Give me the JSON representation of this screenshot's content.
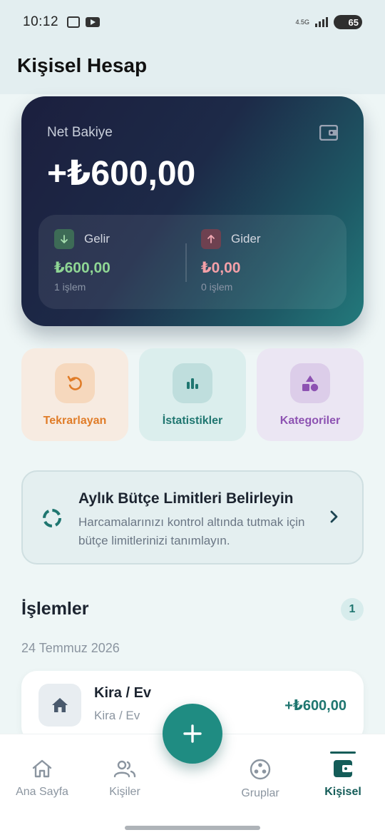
{
  "status_bar": {
    "time": "10:12",
    "network": "4.5G",
    "battery": "65"
  },
  "header": {
    "title": "Kişisel Hesap"
  },
  "balance": {
    "label": "Net Bakiye",
    "amount": "+₺600,00",
    "income": {
      "label": "Gelir",
      "amount": "₺600,00",
      "count": "1 işlem"
    },
    "expense": {
      "label": "Gider",
      "amount": "₺0,00",
      "count": "0 işlem"
    }
  },
  "quick_actions": [
    {
      "label": "Tekrarlayan",
      "icon": "repeat-icon",
      "color": "#e07c28"
    },
    {
      "label": "İstatistikler",
      "icon": "bar-chart-icon",
      "color": "#1f7670"
    },
    {
      "label": "Kategoriler",
      "icon": "shapes-icon",
      "color": "#8d52b2"
    }
  ],
  "budget": {
    "title": "Aylık Bütçe Limitleri Belirleyin",
    "description": "Harcamalarınızı kontrol altında tutmak için bütçe limitlerinizi tanımlayın."
  },
  "transactions": {
    "title": "İşlemler",
    "count": "1",
    "groups": [
      {
        "date": "24 Temmuz 2026",
        "items": [
          {
            "name": "Kira / Ev",
            "category": "Kira / Ev",
            "amount": "+₺600,00",
            "icon": "home-icon"
          }
        ]
      }
    ]
  },
  "bottom_nav": [
    {
      "label": "Ana Sayfa",
      "icon": "home-icon",
      "active": false
    },
    {
      "label": "Kişiler",
      "icon": "people-icon",
      "active": false
    },
    {
      "label": "Gruplar",
      "icon": "groups-icon",
      "active": false
    },
    {
      "label": "Kişisel",
      "icon": "wallet-icon",
      "active": true
    }
  ],
  "fab": {
    "icon": "plus-icon"
  },
  "colors": {
    "accent": "#1f8c82",
    "income": "#8fd694",
    "expense": "#f4a0a8",
    "card_dark": "#1b1f3e"
  }
}
